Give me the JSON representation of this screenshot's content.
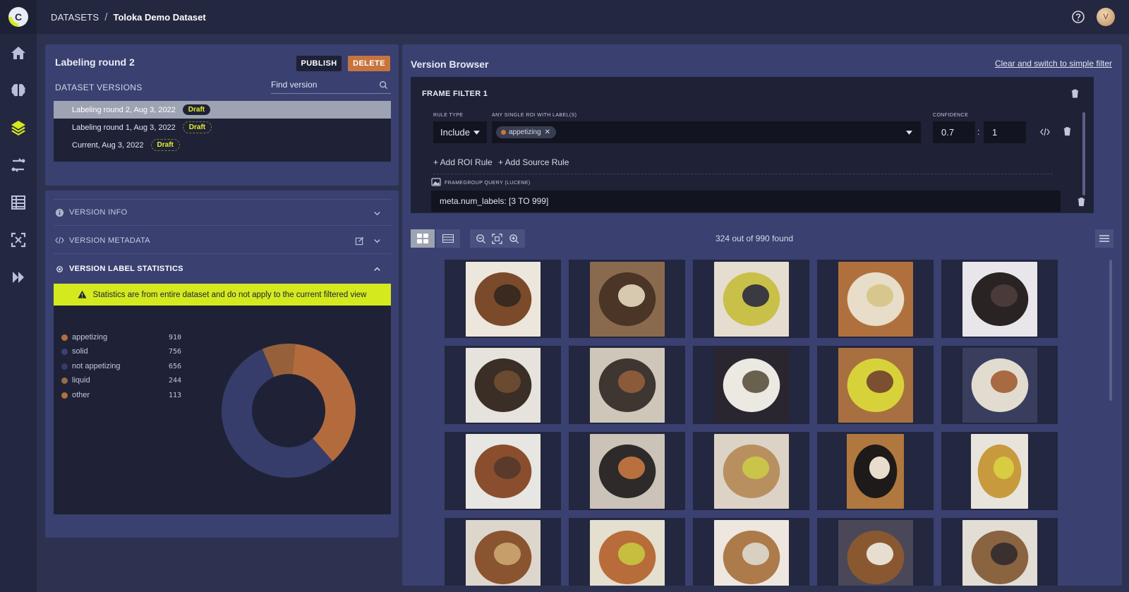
{
  "breadcrumb": {
    "root": "DATASETS",
    "separator": "/",
    "current": "Toloka Demo Dataset"
  },
  "user": {
    "avatar_initial": "V"
  },
  "nav": {
    "items": [
      "home-icon",
      "brain-icon",
      "layers-icon",
      "workflow-icon",
      "table-icon",
      "focus-icon",
      "forward-icon"
    ],
    "active": "layers-icon"
  },
  "round": {
    "title": "Labeling round 2",
    "publish_label": "PUBLISH",
    "delete_label": "DELETE",
    "versions_label": "DATASET VERSIONS",
    "find_placeholder": "Find version",
    "versions": [
      {
        "name": "Labeling round 2, Aug 3, 2022",
        "status": "Draft",
        "selected": true
      },
      {
        "name": "Labeling round 1, Aug 3, 2022",
        "status": "Draft",
        "selected": false
      },
      {
        "name": "Current, Aug 3, 2022",
        "status": "Draft",
        "selected": false
      }
    ]
  },
  "stats": {
    "sections": {
      "info": "VERSION INFO",
      "metadata": "VERSION METADATA",
      "label_stats": "VERSION LABEL STATISTICS"
    },
    "warning": "Statistics are from entire dataset and do not apply to the current filtered view",
    "labels": [
      {
        "name": "appetizing",
        "count": 910,
        "color": "#b56d3f"
      },
      {
        "name": "solid",
        "count": 756,
        "color": "#3b4272"
      },
      {
        "name": "not appetizing",
        "count": 656,
        "color": "#363d6b"
      },
      {
        "name": "liquid",
        "count": 244,
        "color": "#9a6a4a"
      },
      {
        "name": "other",
        "count": 113,
        "color": "#b0703f"
      }
    ],
    "donut_segments": [
      {
        "label": "appetizing",
        "fraction": 0.37,
        "color": "#b36b3d"
      },
      {
        "label": "solid",
        "fraction": 0.55,
        "color": "#363d6b"
      },
      {
        "label": "other",
        "fraction": 0.08,
        "color": "#96613a"
      }
    ]
  },
  "browser": {
    "title": "Version Browser",
    "clear_link": "Clear and switch to simple filter",
    "filter": {
      "title": "FRAME FILTER 1",
      "rule_type_label": "RULE TYPE",
      "rule_type_value": "Include",
      "roi_label": "ANY SINGLE ROI WITH LABEL(S)",
      "chip": "appetizing",
      "confidence_label": "CONFIDENCE",
      "conf_min": "0.7",
      "conf_sep": ":",
      "conf_max": "1",
      "add_roi": "+ Add ROI Rule",
      "add_source": "+ Add Source Rule",
      "framegroup_label": "FRAMEGROUP QUERY (LUCENE)",
      "query": "meta.num_labels: [3 TO 999]"
    },
    "found": "324 out of 990 found",
    "thumbnails": [
      {
        "bg": "#ece6dd",
        "fg": "#7a4a2a",
        "accent": "#3a2a20",
        "ratio": 1.0
      },
      {
        "bg": "#8a6a4e",
        "fg": "#4a3526",
        "accent": "#d6c9b0",
        "ratio": 1.0
      },
      {
        "bg": "#e5ddd0",
        "fg": "#c9c04a",
        "accent": "#3a3a40",
        "ratio": 1.0
      },
      {
        "bg": "#b0703e",
        "fg": "#e8ddc8",
        "accent": "#d7c78c",
        "ratio": 1.0
      },
      {
        "bg": "#e8e6ea",
        "fg": "#2a2324",
        "accent": "#4a3a3a",
        "ratio": 1.0
      },
      {
        "bg": "#e6e2dc",
        "fg": "#3a2e26",
        "accent": "#6a4a30",
        "ratio": 1.0
      },
      {
        "bg": "#cfc6ba",
        "fg": "#3e3630",
        "accent": "#8a5a3a",
        "ratio": 1.0
      },
      {
        "bg": "#2a2630",
        "fg": "#ece8e2",
        "accent": "#6a6050",
        "ratio": 1.0
      },
      {
        "bg": "#a87040",
        "fg": "#d8d23a",
        "accent": "#7a5030",
        "ratio": 1.0
      },
      {
        "bg": "#3a3e5e",
        "fg": "#e2dcd0",
        "accent": "#a86a40",
        "ratio": 1.0
      },
      {
        "bg": "#e8e6e2",
        "fg": "#8a4e2e",
        "accent": "#5a3a2a",
        "ratio": 1.0
      },
      {
        "bg": "#cbc3b8",
        "fg": "#2e2a2a",
        "accent": "#b8703e",
        "ratio": 1.0
      },
      {
        "bg": "#dcd3c6",
        "fg": "#b89060",
        "accent": "#cac44a",
        "ratio": 1.0
      },
      {
        "bg": "#b0783e",
        "fg": "#1e1a1a",
        "accent": "#e8dccc",
        "ratio": 0.76
      },
      {
        "bg": "#e8e4dc",
        "fg": "#c89a3e",
        "accent": "#d8cc40",
        "ratio": 0.76
      },
      {
        "bg": "#ddd6cc",
        "fg": "#8a5430",
        "accent": "#c69e6a",
        "ratio": 1.0
      },
      {
        "bg": "#e4dfcf",
        "fg": "#b86c3a",
        "accent": "#c6be3e",
        "ratio": 1.0
      },
      {
        "bg": "#ede7df",
        "fg": "#ad7a4a",
        "accent": "#d8d0c0",
        "ratio": 1.0
      },
      {
        "bg": "#4a4858",
        "fg": "#8a5830",
        "accent": "#e6ded0",
        "ratio": 1.0
      },
      {
        "bg": "#e2ddd5",
        "fg": "#8a6440",
        "accent": "#3a3030",
        "ratio": 1.0
      }
    ]
  }
}
